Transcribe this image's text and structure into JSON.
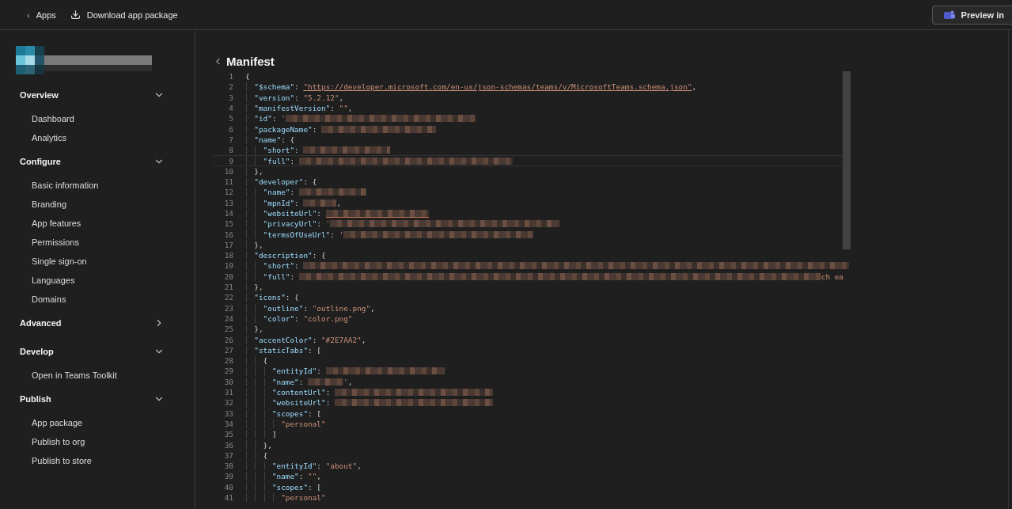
{
  "topbar": {
    "back": {
      "icon": "‹",
      "label": "Apps"
    },
    "download": "Download app package",
    "preview": "Preview in"
  },
  "sidebar": {
    "sections": [
      {
        "title": "Overview",
        "expanded": true,
        "items": [
          "Dashboard",
          "Analytics"
        ]
      },
      {
        "title": "Configure",
        "expanded": true,
        "items": [
          "Basic information",
          "Branding",
          "App features",
          "Permissions",
          "Single sign-on",
          "Languages",
          "Domains"
        ]
      },
      {
        "title": "Advanced",
        "expanded": false
      },
      {
        "title": "Develop",
        "expanded": true,
        "items": [
          "Open in Teams Toolkit"
        ]
      },
      {
        "title": "Publish",
        "expanded": true,
        "items": [
          "App package",
          "Publish to org",
          "Publish to store"
        ]
      }
    ]
  },
  "page": {
    "title": "Manifest"
  },
  "editor": {
    "lines": [
      {
        "n": "1",
        "current": false,
        "parts": [
          {
            "kind": "punct",
            "text": "{"
          }
        ]
      },
      {
        "n": "2",
        "current": false,
        "parts": [
          {
            "kind": "key",
            "text": "\"$schema\""
          },
          {
            "kind": "punct",
            "text": ": "
          },
          {
            "kind": "link",
            "text": "\"https://developer.microsoft.com/en-us/json-schemas/teams/v/MicrosoftTeams.schema.json\""
          },
          {
            "kind": "punct",
            "text": ","
          }
        ]
      },
      {
        "n": "3",
        "current": false,
        "parts": [
          {
            "kind": "key",
            "text": "\"version\""
          },
          {
            "kind": "punct",
            "text": ": "
          },
          {
            "kind": "str",
            "text": "\"5.2.12\""
          },
          {
            "kind": "punct",
            "text": ","
          }
        ]
      },
      {
        "n": "4",
        "current": false,
        "parts": [
          {
            "kind": "key",
            "text": "\"manifestVersion\""
          },
          {
            "kind": "punct",
            "text": ": "
          },
          {
            "kind": "str",
            "text": "\"\""
          },
          {
            "kind": "punct",
            "text": ","
          }
        ]
      },
      {
        "n": "5",
        "current": false,
        "parts": [
          {
            "kind": "key",
            "text": "\"id\""
          },
          {
            "kind": "punct",
            "text": ": "
          },
          {
            "kind": "str",
            "text": "'"
          },
          {
            "kind": "redacted"
          }
        ]
      },
      {
        "n": "6",
        "current": false,
        "parts": [
          {
            "kind": "key",
            "text": "\"packageName\""
          },
          {
            "kind": "punct",
            "text": ": "
          },
          {
            "kind": "redacted"
          }
        ]
      },
      {
        "n": "7",
        "current": false,
        "parts": [
          {
            "kind": "key",
            "text": "\"name\""
          },
          {
            "kind": "punct",
            "text": ": {"
          }
        ]
      },
      {
        "n": "8",
        "current": false,
        "parts": [
          {
            "kind": "key",
            "text": "\"short\""
          },
          {
            "kind": "punct",
            "text": ": "
          },
          {
            "kind": "redacted"
          }
        ]
      },
      {
        "n": "9",
        "current": true,
        "parts": [
          {
            "kind": "key",
            "text": "\"full\""
          },
          {
            "kind": "punct",
            "text": ": "
          },
          {
            "kind": "redacted"
          }
        ]
      },
      {
        "n": "10",
        "current": false,
        "parts": [
          {
            "kind": "punct",
            "text": "},"
          }
        ]
      },
      {
        "n": "11",
        "current": false,
        "parts": [
          {
            "kind": "key",
            "text": "\"developer\""
          },
          {
            "kind": "punct",
            "text": ": {"
          }
        ]
      },
      {
        "n": "12",
        "current": false,
        "parts": [
          {
            "kind": "key",
            "text": "\"name\""
          },
          {
            "kind": "punct",
            "text": ": "
          },
          {
            "kind": "redacted"
          }
        ]
      },
      {
        "n": "13",
        "current": false,
        "parts": [
          {
            "kind": "key",
            "text": "\"mpnId\""
          },
          {
            "kind": "punct",
            "text": ": "
          },
          {
            "kind": "redacted"
          },
          {
            "kind": "punct",
            "text": ","
          }
        ]
      },
      {
        "n": "14",
        "current": false,
        "parts": [
          {
            "kind": "key",
            "text": "\"websiteUrl\""
          },
          {
            "kind": "punct",
            "text": ": "
          },
          {
            "kind": "redacted-link"
          }
        ]
      },
      {
        "n": "15",
        "current": false,
        "parts": [
          {
            "kind": "key",
            "text": "\"privacyUrl\""
          },
          {
            "kind": "punct",
            "text": ": "
          },
          {
            "kind": "str",
            "text": "'"
          },
          {
            "kind": "redacted"
          }
        ]
      },
      {
        "n": "16",
        "current": false,
        "parts": [
          {
            "kind": "key",
            "text": "\"termsOfUseUrl\""
          },
          {
            "kind": "punct",
            "text": ": "
          },
          {
            "kind": "str",
            "text": "'"
          },
          {
            "kind": "redacted"
          }
        ]
      },
      {
        "n": "17",
        "current": false,
        "parts": [
          {
            "kind": "punct",
            "text": "},"
          }
        ]
      },
      {
        "n": "18",
        "current": false,
        "parts": [
          {
            "kind": "key",
            "text": "\"description\""
          },
          {
            "kind": "punct",
            "text": ": {"
          }
        ]
      },
      {
        "n": "19",
        "current": false,
        "parts": [
          {
            "kind": "key",
            "text": "\"short\""
          },
          {
            "kind": "punct",
            "text": ": "
          },
          {
            "kind": "redacted"
          }
        ]
      },
      {
        "n": "20",
        "current": false,
        "parts": [
          {
            "kind": "key",
            "text": "\"full\""
          },
          {
            "kind": "punct",
            "text": ": "
          },
          {
            "kind": "redacted"
          },
          {
            "kind": "str",
            "text": "ch ea"
          }
        ]
      },
      {
        "n": "21",
        "current": false,
        "parts": [
          {
            "kind": "punct",
            "text": "},"
          }
        ]
      },
      {
        "n": "22",
        "current": false,
        "parts": [
          {
            "kind": "key",
            "text": "\"icons\""
          },
          {
            "kind": "punct",
            "text": ": {"
          }
        ]
      },
      {
        "n": "23",
        "current": false,
        "parts": [
          {
            "kind": "key",
            "text": "\"outline\""
          },
          {
            "kind": "punct",
            "text": ": "
          },
          {
            "kind": "str",
            "text": "\"outline.png\""
          },
          {
            "kind": "punct",
            "text": ","
          }
        ]
      },
      {
        "n": "24",
        "current": false,
        "parts": [
          {
            "kind": "key",
            "text": "\"color\""
          },
          {
            "kind": "punct",
            "text": ": "
          },
          {
            "kind": "str",
            "text": "\"color.png\""
          }
        ]
      },
      {
        "n": "25",
        "current": false,
        "parts": [
          {
            "kind": "punct",
            "text": "},"
          }
        ]
      },
      {
        "n": "26",
        "current": false,
        "parts": [
          {
            "kind": "key",
            "text": "\"accentColor\""
          },
          {
            "kind": "punct",
            "text": ": "
          },
          {
            "kind": "str",
            "text": "\"#2E7AA2\""
          },
          {
            "kind": "punct",
            "text": ","
          }
        ]
      },
      {
        "n": "27",
        "current": false,
        "parts": [
          {
            "kind": "key",
            "text": "\"staticTabs\""
          },
          {
            "kind": "punct",
            "text": ": ["
          }
        ]
      },
      {
        "n": "28",
        "current": false,
        "parts": [
          {
            "kind": "punct",
            "text": "{"
          }
        ]
      },
      {
        "n": "29",
        "current": false,
        "parts": [
          {
            "kind": "key",
            "text": "\"entityId\""
          },
          {
            "kind": "punct",
            "text": ": "
          },
          {
            "kind": "redacted"
          }
        ]
      },
      {
        "n": "30",
        "current": false,
        "parts": [
          {
            "kind": "key",
            "text": "\"name\""
          },
          {
            "kind": "punct",
            "text": ": "
          },
          {
            "kind": "redacted"
          },
          {
            "kind": "str",
            "text": "'"
          },
          {
            "kind": "punct",
            "text": ","
          }
        ]
      },
      {
        "n": "31",
        "current": false,
        "parts": [
          {
            "kind": "key",
            "text": "\"contentUrl\""
          },
          {
            "kind": "punct",
            "text": ": "
          },
          {
            "kind": "redacted"
          }
        ]
      },
      {
        "n": "32",
        "current": false,
        "parts": [
          {
            "kind": "key",
            "text": "\"websiteUrl\""
          },
          {
            "kind": "punct",
            "text": ": "
          },
          {
            "kind": "redacted"
          }
        ]
      },
      {
        "n": "33",
        "current": false,
        "parts": [
          {
            "kind": "key",
            "text": "\"scopes\""
          },
          {
            "kind": "punct",
            "text": ": ["
          }
        ]
      },
      {
        "n": "34",
        "current": false,
        "parts": [
          {
            "kind": "str",
            "text": "\"personal\""
          }
        ]
      },
      {
        "n": "35",
        "current": false,
        "parts": [
          {
            "kind": "punct",
            "text": "]"
          }
        ]
      },
      {
        "n": "36",
        "current": false,
        "parts": [
          {
            "kind": "punct",
            "text": "},"
          }
        ]
      },
      {
        "n": "37",
        "current": false,
        "parts": [
          {
            "kind": "punct",
            "text": "{"
          }
        ]
      },
      {
        "n": "38",
        "current": false,
        "parts": [
          {
            "kind": "key",
            "text": "\"entityId\""
          },
          {
            "kind": "punct",
            "text": ": "
          },
          {
            "kind": "str",
            "text": "\"about\""
          },
          {
            "kind": "punct",
            "text": ","
          }
        ]
      },
      {
        "n": "39",
        "current": false,
        "parts": [
          {
            "kind": "key",
            "text": "\"name\""
          },
          {
            "kind": "punct",
            "text": ": "
          },
          {
            "kind": "str",
            "text": "\"\""
          },
          {
            "kind": "punct",
            "text": ","
          }
        ]
      },
      {
        "n": "40",
        "current": false,
        "parts": [
          {
            "kind": "key",
            "text": "\"scopes\""
          },
          {
            "kind": "punct",
            "text": ": ["
          }
        ]
      },
      {
        "n": "41",
        "current": false,
        "parts": [
          {
            "kind": "str",
            "text": "\"personal\""
          }
        ]
      }
    ]
  }
}
